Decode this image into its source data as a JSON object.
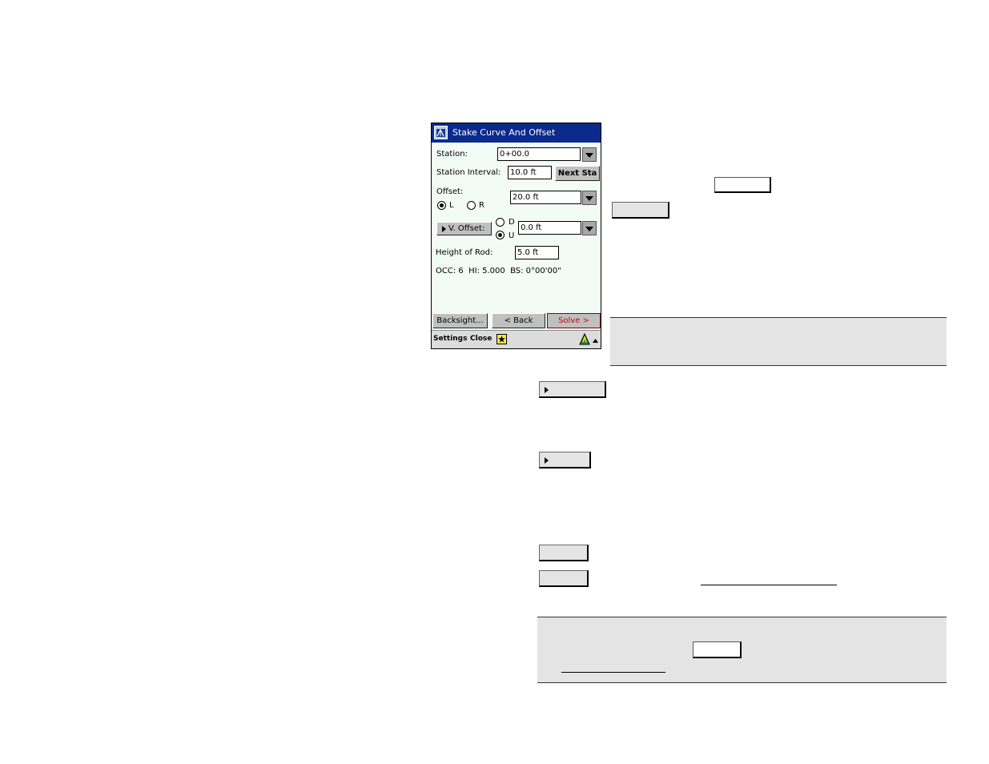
{
  "window": {
    "title": "Stake Curve And Offset"
  },
  "station": {
    "label": "Station:",
    "value": "0+00.0"
  },
  "station_interval": {
    "label": "Station Interval:",
    "value": "10.0 ft",
    "next_label": "Next Sta"
  },
  "offset": {
    "label": "Offset:",
    "value": "20.0 ft",
    "left_label": "L",
    "right_label": "R"
  },
  "v_offset": {
    "button_label": "V. Offset:",
    "down_label": "D",
    "up_label": "U",
    "value": "0.0 ft"
  },
  "rod": {
    "label": "Height of Rod:",
    "value": "5.0 ft"
  },
  "status_line": "OCC: 6  HI: 5.000  BS: 0°00'00\"",
  "buttons": {
    "backsight": "Backsight...",
    "back": "< Back",
    "solve": "Solve >"
  },
  "taskbar": {
    "settings": "Settings",
    "close": "Close"
  },
  "colors": {
    "title_bar": "#0a2a8c",
    "solve_text": "#cc0000",
    "window_bg": "#f3fbf6"
  }
}
